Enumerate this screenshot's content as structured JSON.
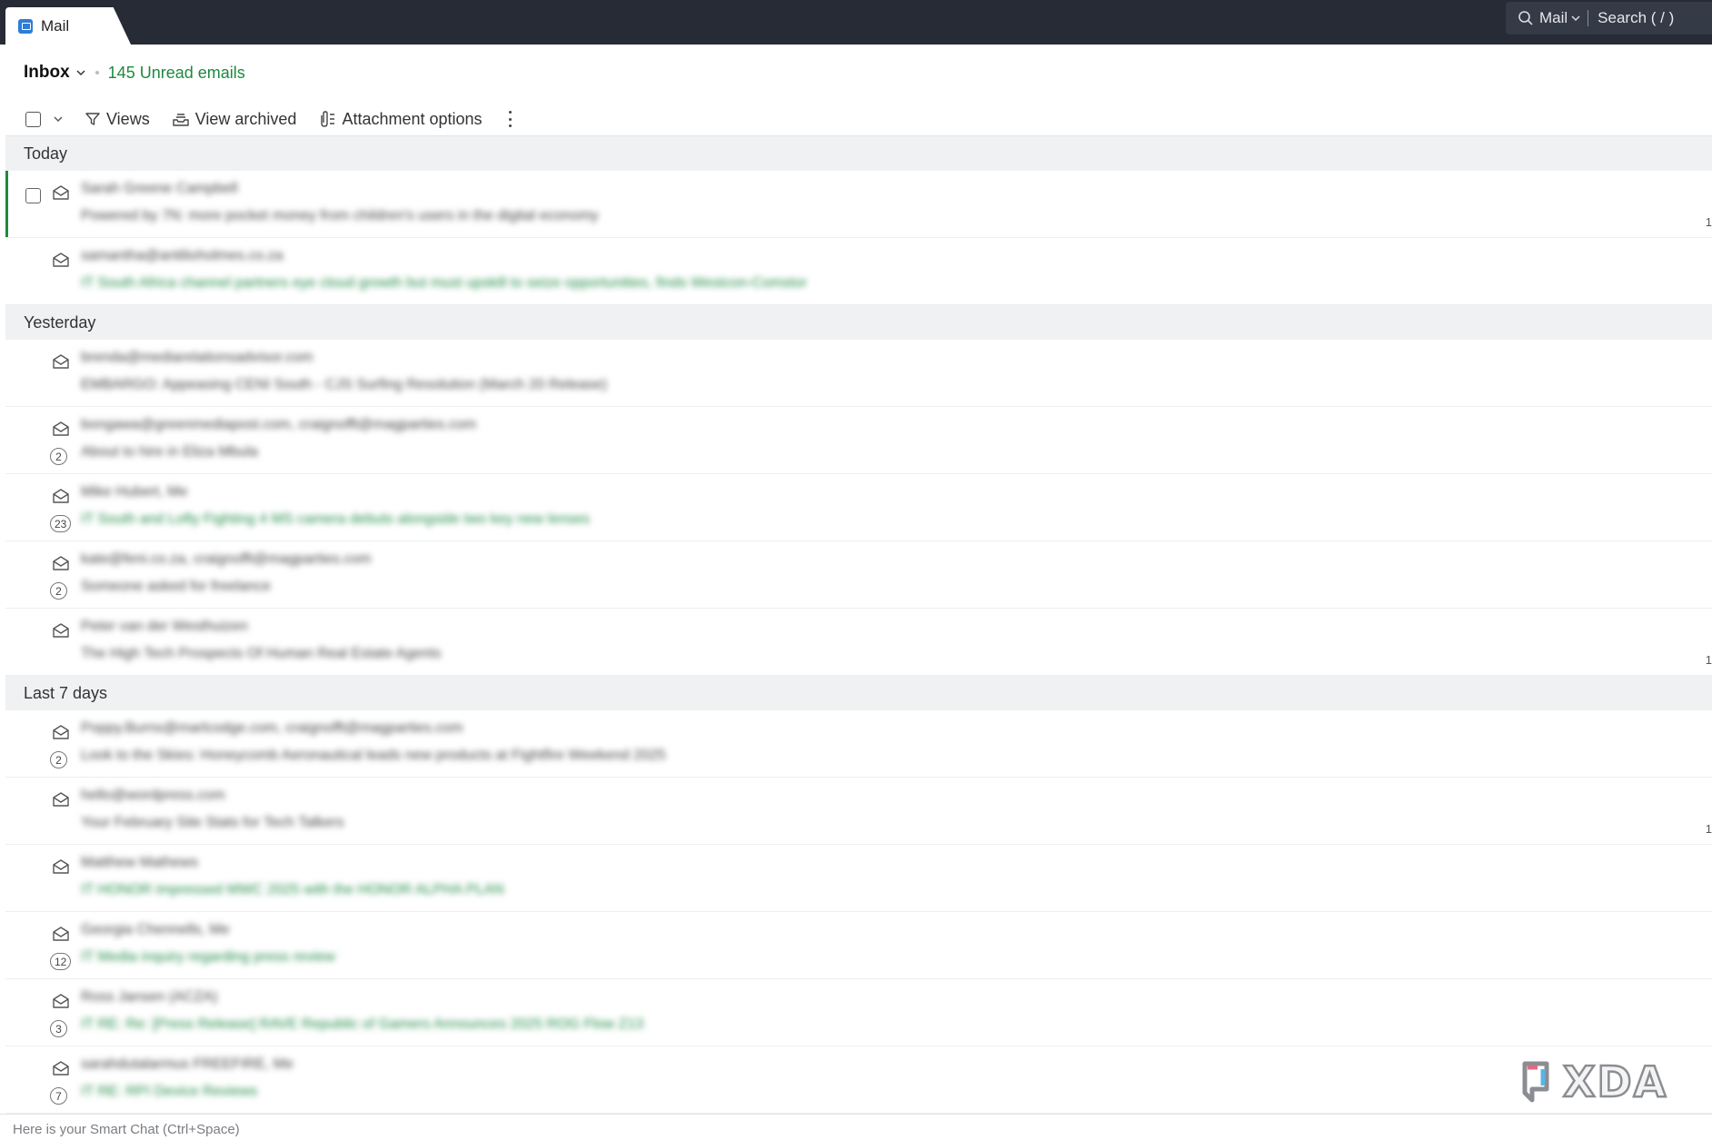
{
  "app": {
    "tab_label": "Mail",
    "tab_icon": "mail-app-icon"
  },
  "search": {
    "scope": "Mail",
    "placeholder": "Search ( / )"
  },
  "header": {
    "folder": "Inbox",
    "unread_text": "145 Unread emails",
    "unread_color": "#1d8a3e"
  },
  "toolbar": {
    "views_label": "Views",
    "view_archived_label": "View archived",
    "attachment_options_label": "Attachment options"
  },
  "groups": [
    {
      "label": "Today",
      "rows": [
        {
          "sender": "Sarah Greene Campbell",
          "subject": "Powered by 7N: more pocket money from children's users in the digital economy",
          "count": "",
          "time": "1",
          "selected": true,
          "subject_green": false
        },
        {
          "sender": "samantha@antilioholmes.co.za",
          "subject": "IT South Africa channel partners eye cloud growth but must upskill to seize opportunities, finds Westcon-Comstor",
          "count": "",
          "time": "",
          "selected": false,
          "subject_green": true
        }
      ]
    },
    {
      "label": "Yesterday",
      "rows": [
        {
          "sender": "brenda@mediarelationsadvisor.com",
          "subject": "EMBARGO: Appeasing CENI South - CJS Surfing Resolution (March 20 Release)",
          "count": "",
          "time": "",
          "selected": false,
          "subject_green": false
        },
        {
          "sender": "bongawa@greenmediapost.com, craignofft@magparties.com",
          "subject": "About to hire in Eliza Mbula",
          "count": "2",
          "time": "",
          "selected": false,
          "subject_green": false
        },
        {
          "sender": "Mike Hubert, Me",
          "subject": "IT South and Lofty Fighting 4 MS camera debuts alongside two key new lenses",
          "count": "23",
          "time": "",
          "selected": false,
          "subject_green": true
        },
        {
          "sender": "kate@feni.co.za, craignofft@magparties.com",
          "subject": "Someone asked for freelance",
          "count": "2",
          "time": "",
          "selected": false,
          "subject_green": false
        },
        {
          "sender": "Peter van der Westhuizen",
          "subject": "The High Tech Prospects Of Human Real Estate Agents",
          "count": "",
          "time": "1",
          "selected": false,
          "subject_green": false
        }
      ]
    },
    {
      "label": "Last 7 days",
      "rows": [
        {
          "sender": "Poppy.Burns@marlcodge.com, craignofft@magparties.com",
          "subject": "Look to the Skies: Honeycomb Aeronautical leads new products at Fightfire Weekend 2025",
          "count": "2",
          "time": "",
          "selected": false,
          "subject_green": false
        },
        {
          "sender": "hello@wordpress.com",
          "subject": "Your February Site Stats for Tech Talkers",
          "count": "",
          "time": "1",
          "selected": false,
          "subject_green": false
        },
        {
          "sender": "Matthew Mathews",
          "subject": "IT HONOR impressed MWC 2025 with the HONOR ALPHA PLAN",
          "count": "",
          "time": "",
          "selected": false,
          "subject_green": true
        },
        {
          "sender": "Georgia Chennells, Me",
          "subject": "IT Media inquiry regarding press review",
          "count": "12",
          "time": "",
          "selected": false,
          "subject_green": true
        },
        {
          "sender": "Ross Jansen (ACZA)",
          "subject": "IT RE: Re: [Press Release] RAVE Republic of Gamers Announces 2025 ROG Flow Z13",
          "count": "3",
          "time": "",
          "selected": false,
          "subject_green": true
        },
        {
          "sender": "sarahdutalarmus FREEFIRE, Me",
          "subject": "IT RE: RPI Device Reviews",
          "count": "7",
          "time": "",
          "selected": false,
          "subject_green": true
        }
      ]
    }
  ],
  "smart_chat": {
    "placeholder": "Here is your Smart Chat (Ctrl+Space)"
  },
  "watermark": {
    "text": "XDA"
  },
  "colors": {
    "topbar": "#262b35",
    "accent_green": "#1d8a3e",
    "group_header_bg": "#f0f1f3"
  }
}
